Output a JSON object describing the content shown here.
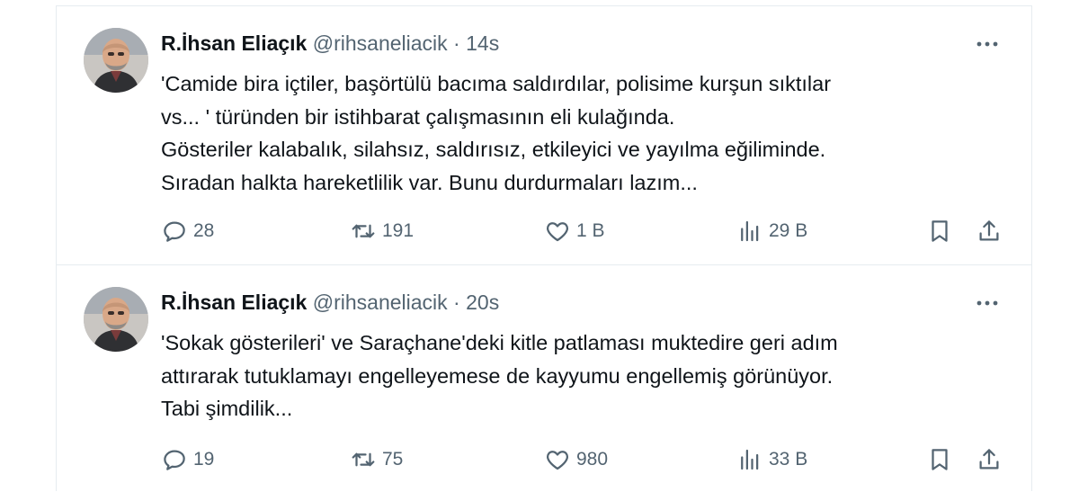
{
  "tweets": [
    {
      "author_name": "R.İhsan Eliaçık",
      "handle": "@rihsaneliacik",
      "separator": "·",
      "time": "14s",
      "text": "'Camide bira içtiler, başörtülü bacıma  saldırdılar, polisime kurşun sıktılar\nvs... ' türünden bir istihbarat çalışmasının eli kulağında.\nGösteriler kalabalık, silahsız, saldırısız, etkileyici ve yayılma eğiliminde.\nSıradan halkta hareketlilik var. Bunu durdurmaları lazım...",
      "replies": "28",
      "retweets": "191",
      "likes": "1 B",
      "views": "29 B"
    },
    {
      "author_name": "R.İhsan Eliaçık",
      "handle": "@rihsaneliacik",
      "separator": "·",
      "time": "20s",
      "text": "'Sokak gösterileri' ve Saraçhane'deki kitle patlaması muktedire geri adım\nattırarak tutuklamayı engelleyemese de kayyumu engellemiş  görünüyor.\nTabi şimdilik...",
      "replies": "19",
      "retweets": "75",
      "likes": "980",
      "views": "33 B"
    }
  ],
  "icons": {
    "reply": "reply-icon",
    "retweet": "retweet-icon",
    "like": "heart-icon",
    "views": "views-icon",
    "bookmark": "bookmark-icon",
    "share": "share-icon",
    "more": "more-icon"
  },
  "colors": {
    "text_primary": "#0f1419",
    "text_secondary": "#536471",
    "divider": "#e6ecf0"
  }
}
